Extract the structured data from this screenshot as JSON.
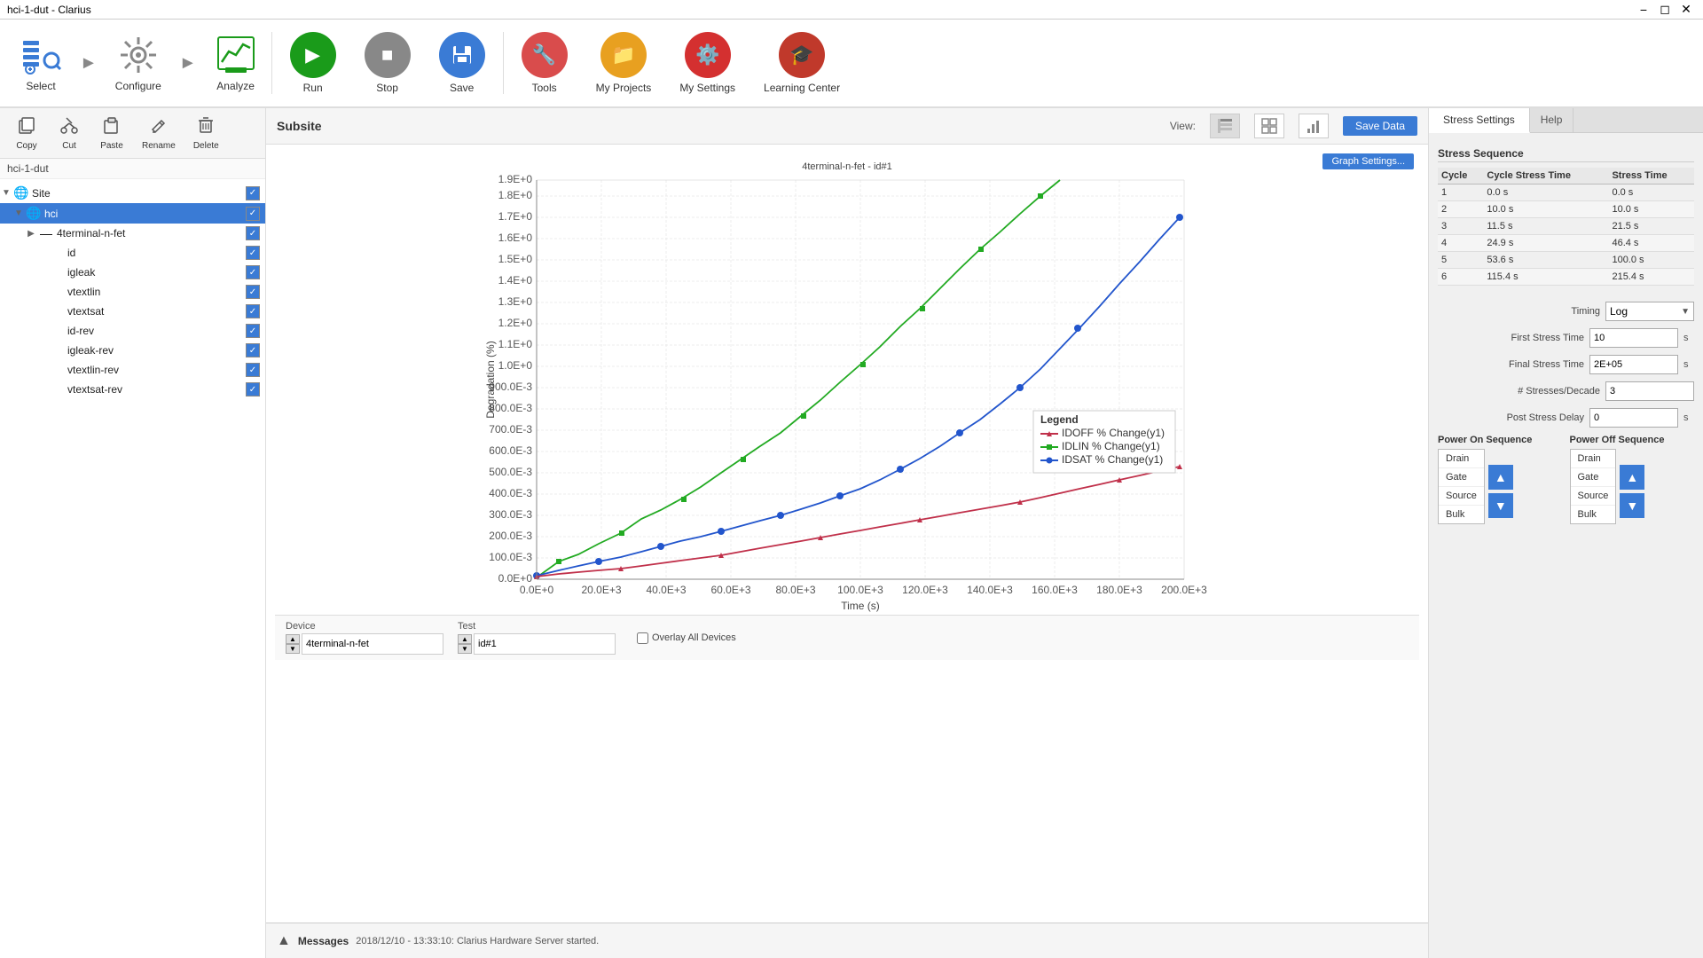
{
  "window": {
    "title": "hci-1-dut - Clarius"
  },
  "toolbar": {
    "select_label": "Select",
    "configure_label": "Configure",
    "analyze_label": "Analyze",
    "run_label": "Run",
    "stop_label": "Stop",
    "save_label": "Save",
    "tools_label": "Tools",
    "myprojects_label": "My Projects",
    "mysettings_label": "My Settings",
    "learning_label": "Learning Center"
  },
  "left_toolbar": {
    "copy_label": "Copy",
    "cut_label": "Cut",
    "paste_label": "Paste",
    "rename_label": "Rename",
    "delete_label": "Delete"
  },
  "tree_path": "hci-1-dut",
  "tree": [
    {
      "label": "Site",
      "level": 1,
      "icon": "🌐",
      "expandable": true,
      "checked": true
    },
    {
      "label": "hci",
      "level": 2,
      "icon": "🌐",
      "expandable": true,
      "checked": true,
      "selected": true
    },
    {
      "label": "4terminal-n-fet",
      "level": 3,
      "icon": "—",
      "expandable": true,
      "checked": true
    },
    {
      "label": "id",
      "level": 4,
      "icon": "",
      "checked": true
    },
    {
      "label": "igleak",
      "level": 4,
      "icon": "",
      "checked": true
    },
    {
      "label": "vtextlin",
      "level": 4,
      "icon": "",
      "checked": true
    },
    {
      "label": "vtextsat",
      "level": 4,
      "icon": "",
      "checked": true
    },
    {
      "label": "id-rev",
      "level": 4,
      "icon": "",
      "checked": true
    },
    {
      "label": "igleak-rev",
      "level": 4,
      "icon": "",
      "checked": true
    },
    {
      "label": "vtextlin-rev",
      "level": 4,
      "icon": "",
      "checked": true
    },
    {
      "label": "vtextsat-rev",
      "level": 4,
      "icon": "",
      "checked": true
    }
  ],
  "chart": {
    "title": "4terminal-n-fet - id#1",
    "x_label": "Time (s)",
    "y_label": "Degradation (%)",
    "x_ticks": [
      "0.0E+0",
      "20.0E+3",
      "40.0E+3",
      "60.0E+3",
      "80.0E+3",
      "100.0E+3",
      "120.0E+3",
      "140.0E+3",
      "160.0E+3",
      "180.0E+3",
      "200.0E+3"
    ],
    "y_ticks": [
      "0.0E+0",
      "100.0E-3",
      "200.0E-3",
      "300.0E-3",
      "400.0E-3",
      "500.0E-3",
      "600.0E-3",
      "700.0E-3",
      "800.0E-3",
      "900.0E-3",
      "1.0E+0",
      "1.1E+0",
      "1.2E+0",
      "1.3E+0",
      "1.4E+0",
      "1.5E+0",
      "1.6E+0",
      "1.7E+0",
      "1.8E+0",
      "1.9E+0"
    ],
    "legend": [
      {
        "label": "IDOFF % Change(y1)",
        "color": "#c0304a"
      },
      {
        "label": "IDLIN % Change(y1)",
        "color": "#22aa22"
      },
      {
        "label": "IDSAT % Change(y1)",
        "color": "#2255cc"
      }
    ]
  },
  "subsite": {
    "title": "Subsite",
    "view_label": "View:",
    "save_data_label": "Save Data",
    "graph_settings_label": "Graph Settings..."
  },
  "device_test": {
    "device_label": "Device",
    "device_value": "4terminal-n-fet",
    "test_label": "Test",
    "test_value": "id#1",
    "overlay_label": "Overlay All Devices"
  },
  "messages": {
    "label": "Messages",
    "text": "2018/12/10 - 13:33:10: Clarius Hardware Server started."
  },
  "right_panel": {
    "tab_stress": "Stress Settings",
    "tab_help": "Help",
    "section_stress_sequence": "Stress Sequence",
    "table_headers": [
      "Cycle",
      "Cycle Stress Time",
      "Stress Time"
    ],
    "table_rows": [
      [
        "1",
        "0.0 s",
        "0.0 s"
      ],
      [
        "2",
        "10.0 s",
        "10.0 s"
      ],
      [
        "3",
        "11.5 s",
        "21.5 s"
      ],
      [
        "4",
        "24.9 s",
        "46.4 s"
      ],
      [
        "5",
        "53.6 s",
        "100.0 s"
      ],
      [
        "6",
        "115.4 s",
        "215.4 s"
      ]
    ],
    "timing_label": "Timing",
    "timing_value": "Log",
    "first_stress_time_label": "First Stress Time",
    "first_stress_time_value": "10",
    "first_stress_time_unit": "s",
    "final_stress_time_label": "Final Stress Time",
    "final_stress_time_value": "2E+05",
    "final_stress_time_unit": "s",
    "stresses_per_decade_label": "# Stresses/Decade",
    "stresses_per_decade_value": "3",
    "post_stress_delay_label": "Post Stress Delay",
    "post_stress_delay_value": "0",
    "post_stress_delay_unit": "s",
    "power_on_label": "Power On Sequence",
    "power_off_label": "Power Off Sequence",
    "power_on_items": [
      "Drain",
      "Gate",
      "Source",
      "Bulk"
    ],
    "power_off_items": [
      "Drain",
      "Gate",
      "Source",
      "Bulk"
    ]
  }
}
